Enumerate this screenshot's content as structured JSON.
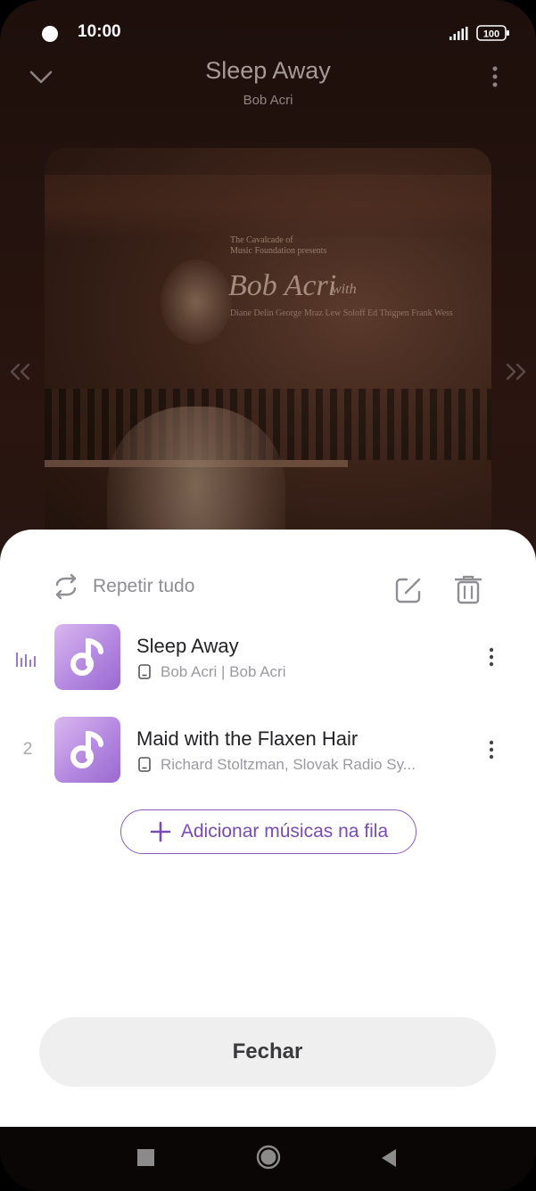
{
  "status_bar": {
    "time": "10:00",
    "battery": "100"
  },
  "player": {
    "title": "Sleep Away",
    "artist": "Bob Acri",
    "album_art": {
      "line1": "The Cavalcade of",
      "line2": "Music Foundation presents",
      "name": "Bob Acri",
      "with": "with",
      "line3": "Diane Delin George Mraz Lew Soloff Ed Thigpen Frank Wess"
    }
  },
  "queue_sheet": {
    "repeat_label": "Repetir tudo",
    "items": [
      {
        "index": "",
        "playing": true,
        "title": "Sleep Away",
        "subtitle": "Bob Acri | Bob Acri"
      },
      {
        "index": "2",
        "playing": false,
        "title": "Maid with the Flaxen Hair",
        "subtitle": "Richard Stoltzman, Slovak Radio Sy..."
      }
    ],
    "add_button_label": "Adicionar músicas na fila",
    "close_button_label": "Fechar"
  },
  "colors": {
    "accent": "#7a4bb3",
    "thumb_gradient_start": "#d9b8f0",
    "thumb_gradient_end": "#9a6ad0"
  }
}
